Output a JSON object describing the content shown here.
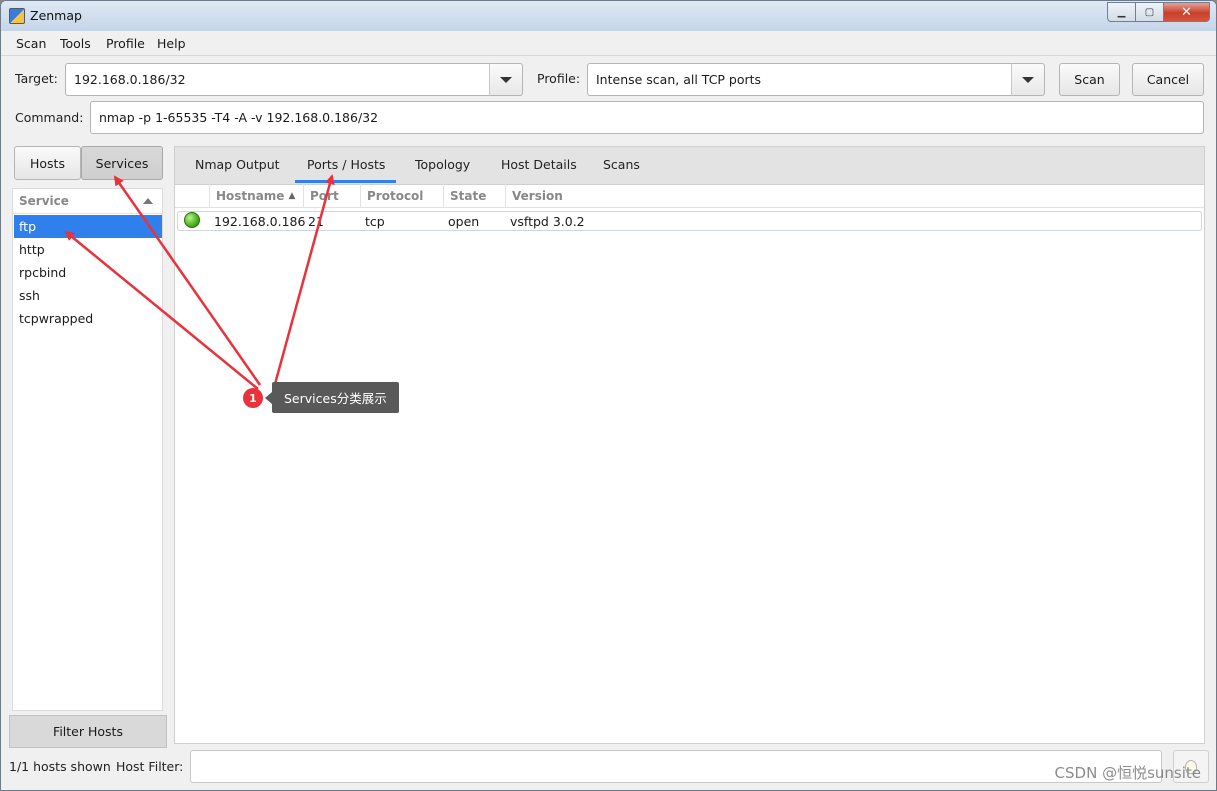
{
  "window": {
    "title": "Zenmap"
  },
  "menu": [
    "Scan",
    "Tools",
    "Profile",
    "Help"
  ],
  "target": {
    "label": "Target:",
    "value": "192.168.0.186/32"
  },
  "profile": {
    "label": "Profile:",
    "value": "Intense scan, all TCP ports"
  },
  "buttons": {
    "scan": "Scan",
    "cancel": "Cancel"
  },
  "command": {
    "label": "Command:",
    "value": "nmap -p 1-65535 -T4 -A -v 192.168.0.186/32"
  },
  "sidebar": {
    "toggle_hosts": "Hosts",
    "toggle_services": "Services",
    "list_header": "Service",
    "services": [
      "ftp",
      "http",
      "rpcbind",
      "ssh",
      "tcpwrapped"
    ],
    "filter_button": "Filter Hosts"
  },
  "tabs": [
    "Nmap Output",
    "Ports / Hosts",
    "Topology",
    "Host Details",
    "Scans"
  ],
  "table": {
    "columns": [
      "Hostname",
      "Port",
      "Protocol",
      "State",
      "Version"
    ],
    "rows": [
      {
        "hostname": "192.168.0.186",
        "port": "21",
        "protocol": "tcp",
        "state": "open",
        "version": "vsftpd 3.0.2"
      }
    ]
  },
  "status": {
    "hosts_shown": "1/1 hosts shown",
    "host_filter_label": "Host Filter:"
  },
  "annotation": {
    "badge": "1",
    "text": "Services分类展示",
    "color": "#e8323c"
  },
  "watermark": "CSDN @恒悦sunsite"
}
